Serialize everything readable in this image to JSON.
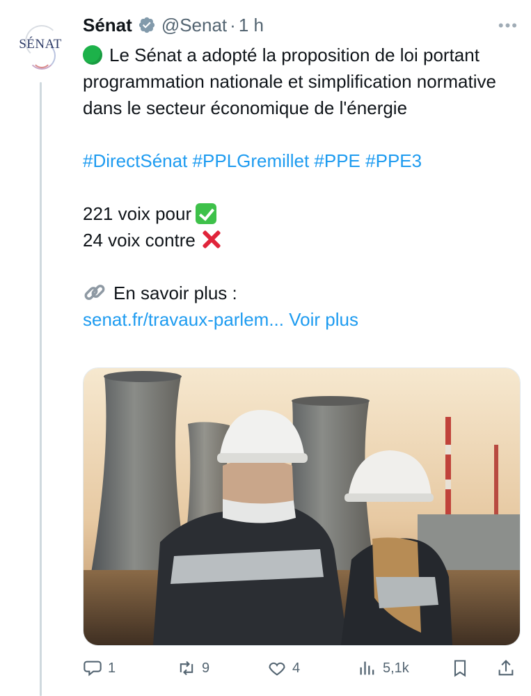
{
  "author": {
    "avatar_text": "SÉNAT",
    "name": "Sénat",
    "handle": "@Senat",
    "separator": "·",
    "time": "1 h"
  },
  "tweet": {
    "line1": "Le Sénat a adopté la proposition de loi portant programmation nationale et simplification normative dans le secteur économique de l'énergie",
    "hashtags": [
      "#DirectSénat",
      "#PPLGremillet",
      "#PPE",
      "#PPE3"
    ],
    "votes_for": "221 voix pour",
    "votes_against": "24 voix contre",
    "more_label": "En savoir plus :",
    "link_text": "senat.fr/travaux-parlem...",
    "show_more": "Voir plus"
  },
  "media": {
    "description_icon": "image"
  },
  "actions": {
    "replies": "1",
    "retweets": "9",
    "likes": "4",
    "views": "5,1k"
  },
  "colors": {
    "accent": "#1d9bf0",
    "muted": "#536471"
  }
}
